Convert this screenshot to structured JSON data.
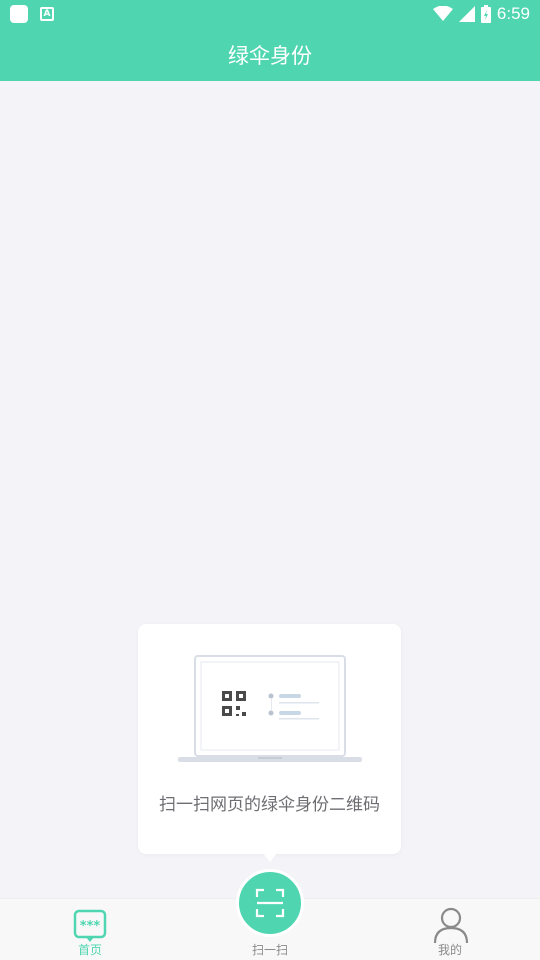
{
  "status_bar": {
    "time": "6:59",
    "icons": [
      "app-icon",
      "a-icon",
      "wifi-icon",
      "signal-icon",
      "battery-charging-icon"
    ]
  },
  "app_bar": {
    "title": "绿伞身份"
  },
  "popup": {
    "text": "扫一扫网页的绿伞身份二维码",
    "illustration": "laptop-qr-icon"
  },
  "tab_bar": {
    "tabs": [
      {
        "label": "首页",
        "icon": "password-icon",
        "active": true
      },
      {
        "label": "扫一扫",
        "icon": "scan-icon",
        "active": false
      },
      {
        "label": "我的",
        "icon": "person-icon",
        "active": false
      }
    ]
  },
  "colors": {
    "accent": "#4fd6b0",
    "background": "#f3f3f8",
    "text_muted": "#6d6d72"
  }
}
